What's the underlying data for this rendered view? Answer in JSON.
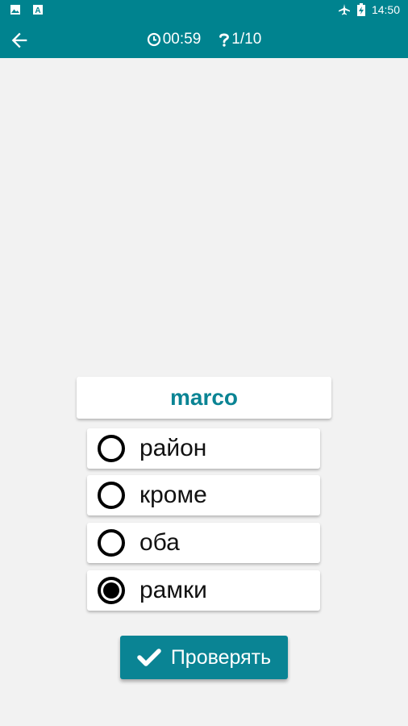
{
  "status_bar": {
    "time": "14:50",
    "icons": [
      "image-icon",
      "font-icon",
      "airplane-icon",
      "battery-charging-icon"
    ]
  },
  "toolbar": {
    "back_icon": "arrow-back-icon",
    "timer": "00:59",
    "timer_icon": "clock-icon",
    "progress": "1/10",
    "progress_icon": "question-icon"
  },
  "quiz": {
    "word": "marco",
    "options": [
      {
        "label": "район",
        "selected": false
      },
      {
        "label": "кроме",
        "selected": false
      },
      {
        "label": "оба",
        "selected": false
      },
      {
        "label": "рамки",
        "selected": true
      }
    ],
    "check_label": "Проверять",
    "check_icon": "checkmark-icon"
  },
  "colors": {
    "primary": "#00838f",
    "accent_text": "#0a8494",
    "background": "#f2f2f2"
  }
}
